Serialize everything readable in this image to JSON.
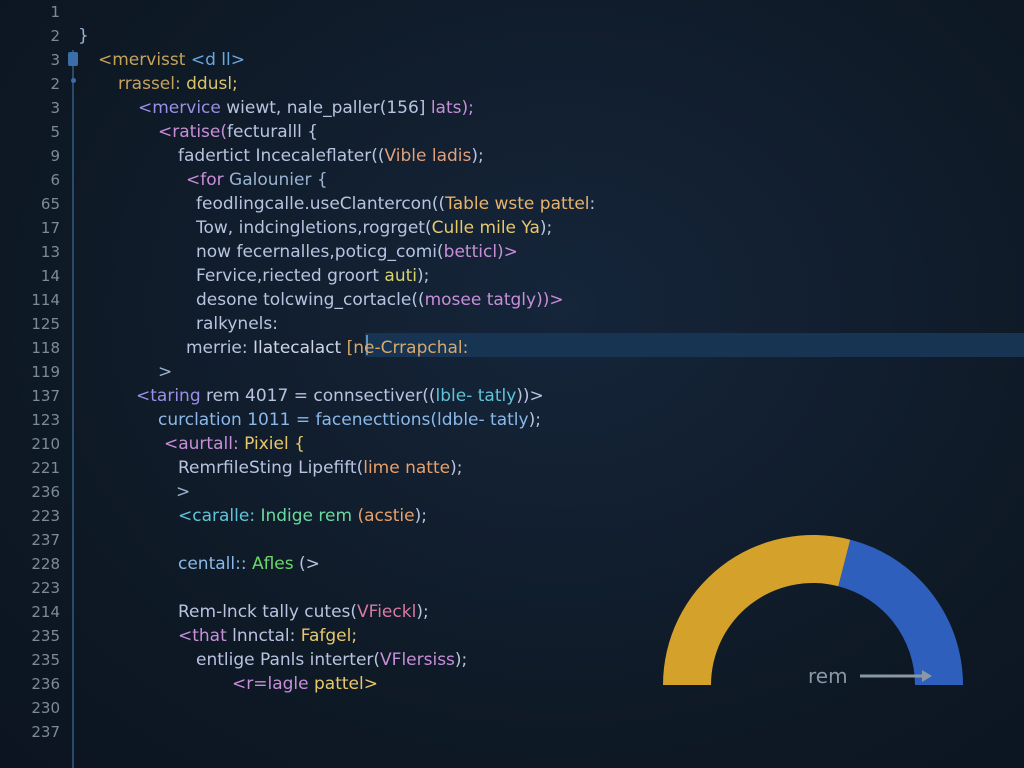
{
  "colors": {
    "background": "#0f1a27",
    "line_number": "#7d8b99",
    "highlight_row": "#173452",
    "gauge_yellow": "#d4a12a",
    "gauge_blue": "#2e5fbd"
  },
  "lines": [
    {
      "num": "1",
      "top": 0,
      "segs": []
    },
    {
      "num": "2",
      "segs": [
        {
          "t": "}",
          "c": "#9ab3d0"
        }
      ]
    },
    {
      "num": "3",
      "segs": [
        {
          "t": "<mervisst ",
          "c": "#c7a35a"
        },
        {
          "t": "<d ll>",
          "c": "#6aa7e0"
        }
      ]
    },
    {
      "num": "2",
      "segs": [
        {
          "t": "rrassel: ",
          "c": "#c7a35a"
        },
        {
          "t": "ddusl;",
          "c": "#d9c46a"
        }
      ]
    },
    {
      "num": "3",
      "segs": [
        {
          "t": "<mervice ",
          "c": "#9a8fe6"
        },
        {
          "t": "wiewt, nale_paller(156] ",
          "c": "#b9c3e0"
        },
        {
          "t": "lats);",
          "c": "#c88ed8"
        }
      ]
    },
    {
      "num": "5",
      "segs": [
        {
          "t": "<ratise(",
          "c": "#c88ed8"
        },
        {
          "t": "fecturalll {",
          "c": "#b9c3e0"
        }
      ]
    },
    {
      "num": "9",
      "segs": [
        {
          "t": "fadertict Incecaleflater((",
          "c": "#b9c3e0"
        },
        {
          "t": "Vible ladis",
          "c": "#e0a07a"
        },
        {
          "t": ");",
          "c": "#b9c3e0"
        }
      ]
    },
    {
      "num": "6",
      "segs": [
        {
          "t": "<for ",
          "c": "#c88ed8"
        },
        {
          "t": "Galounier {",
          "c": "#9ab3d0"
        }
      ]
    },
    {
      "num": "65",
      "segs": [
        {
          "t": "feodlingcalle.useClantercon((",
          "c": "#b9c3e0"
        },
        {
          "t": "Table wste pattel",
          "c": "#e8b46a"
        },
        {
          "t": ":",
          "c": "#b9c3e0"
        }
      ]
    },
    {
      "num": "17",
      "segs": [
        {
          "t": "Tow, indcingletions,rogrget(",
          "c": "#b9c3e0"
        },
        {
          "t": "Culle mile Ya",
          "c": "#e8c86a"
        },
        {
          "t": ");",
          "c": "#b9c3e0"
        }
      ]
    },
    {
      "num": "13",
      "segs": [
        {
          "t": "now fecernalles,poticg_comi(",
          "c": "#b9c3e0"
        },
        {
          "t": "betticl",
          "c": "#c88ed8"
        },
        {
          "t": ")>",
          "c": "#c88ed8"
        }
      ]
    },
    {
      "num": "14",
      "segs": [
        {
          "t": "Fervice,riected groort ",
          "c": "#b9c3e0"
        },
        {
          "t": "auti",
          "c": "#d9d46a"
        },
        {
          "t": ");",
          "c": "#b9c3e0"
        }
      ]
    },
    {
      "num": "114",
      "segs": [
        {
          "t": "desone tolcwing_cortacle((",
          "c": "#b9c3e0"
        },
        {
          "t": "mosee tatgly",
          "c": "#c88ed8"
        },
        {
          "t": "))>",
          "c": "#c88ed8"
        }
      ]
    },
    {
      "num": "125",
      "segs": [
        {
          "t": "ralkynels:",
          "c": "#b9c3e0"
        }
      ]
    },
    {
      "num": "118",
      "segs": [
        {
          "t": "merrie: ",
          "c": "#b9c3e0"
        },
        {
          "t": "Ilatecalact ",
          "c": "#cfd6e4"
        },
        {
          "t": "[ne-Crrapchal:",
          "c": "#d9a86a"
        }
      ]
    },
    {
      "num": "119",
      "segs": [
        {
          "t": ">",
          "c": "#9ab3d0"
        }
      ]
    },
    {
      "num": "137",
      "segs": [
        {
          "t": "<taring ",
          "c": "#9a8fe6"
        },
        {
          "t": "rem 4017 = connsectiver((",
          "c": "#b9c3e0"
        },
        {
          "t": "lble- tatly",
          "c": "#5fc4d9"
        },
        {
          "t": "))>",
          "c": "#b9c3e0"
        }
      ]
    },
    {
      "num": "123",
      "segs": [
        {
          "t": "curclation 1011 = facenecttions(",
          "c": "#8ab8e8"
        },
        {
          "t": "ldble- tatly",
          "c": "#8ab8e8"
        },
        {
          "t": ");",
          "c": "#b9c3e0"
        }
      ]
    },
    {
      "num": "210",
      "segs": [
        {
          "t": "<aurtall: ",
          "c": "#c88ed8"
        },
        {
          "t": "Pixiel {",
          "c": "#e8c86a"
        }
      ]
    },
    {
      "num": "221",
      "segs": [
        {
          "t": "RemrfileSting Lipefift(",
          "c": "#b9c3e0"
        },
        {
          "t": "lime natte",
          "c": "#e8a06a"
        },
        {
          "t": ");",
          "c": "#b9c3e0"
        }
      ]
    },
    {
      "num": "236",
      "segs": [
        {
          "t": ">",
          "c": "#9ab3d0"
        }
      ]
    },
    {
      "num": "223",
      "segs": [
        {
          "t": "<caralle: ",
          "c": "#5fc4d9"
        },
        {
          "t": "Indige rem ",
          "c": "#6ad9a0"
        },
        {
          "t": "(acstie",
          "c": "#e8a06a"
        },
        {
          "t": ");",
          "c": "#b9c3e0"
        }
      ]
    },
    {
      "num": "237",
      "segs": []
    },
    {
      "num": "228",
      "segs": [
        {
          "t": "centall:: ",
          "c": "#8ab8e8"
        },
        {
          "t": "Afles ",
          "c": "#6ad96a"
        },
        {
          "t": "(>",
          "c": "#b9c3e0"
        }
      ]
    },
    {
      "num": "223",
      "segs": []
    },
    {
      "num": "214",
      "segs": [
        {
          "t": "Rem-lnck tally cutes(",
          "c": "#b9c3e0"
        },
        {
          "t": "VFieckl",
          "c": "#d97aa0"
        },
        {
          "t": ");",
          "c": "#b9c3e0"
        }
      ]
    },
    {
      "num": "235",
      "segs": [
        {
          "t": "<that ",
          "c": "#c88ed8"
        },
        {
          "t": "lnnctal: ",
          "c": "#b9c3e0"
        },
        {
          "t": "Fafgel;",
          "c": "#e8c86a"
        }
      ]
    },
    {
      "num": "235",
      "segs": [
        {
          "t": "entlige Panls interter(",
          "c": "#b9c3e0"
        },
        {
          "t": "VFlersiss",
          "c": "#c88ed8"
        },
        {
          "t": ");",
          "c": "#b9c3e0"
        }
      ]
    },
    {
      "num": "236",
      "segs": [
        {
          "t": "<r=lagle ",
          "c": "#c88ed8"
        },
        {
          "t": "pattel>",
          "c": "#e8c86a"
        }
      ]
    },
    {
      "num": "230",
      "segs": []
    },
    {
      "num": "237",
      "segs": []
    }
  ],
  "gauge": {
    "label": "rem",
    "value": 0.58,
    "arrow_icon": "arrow-right-icon"
  }
}
